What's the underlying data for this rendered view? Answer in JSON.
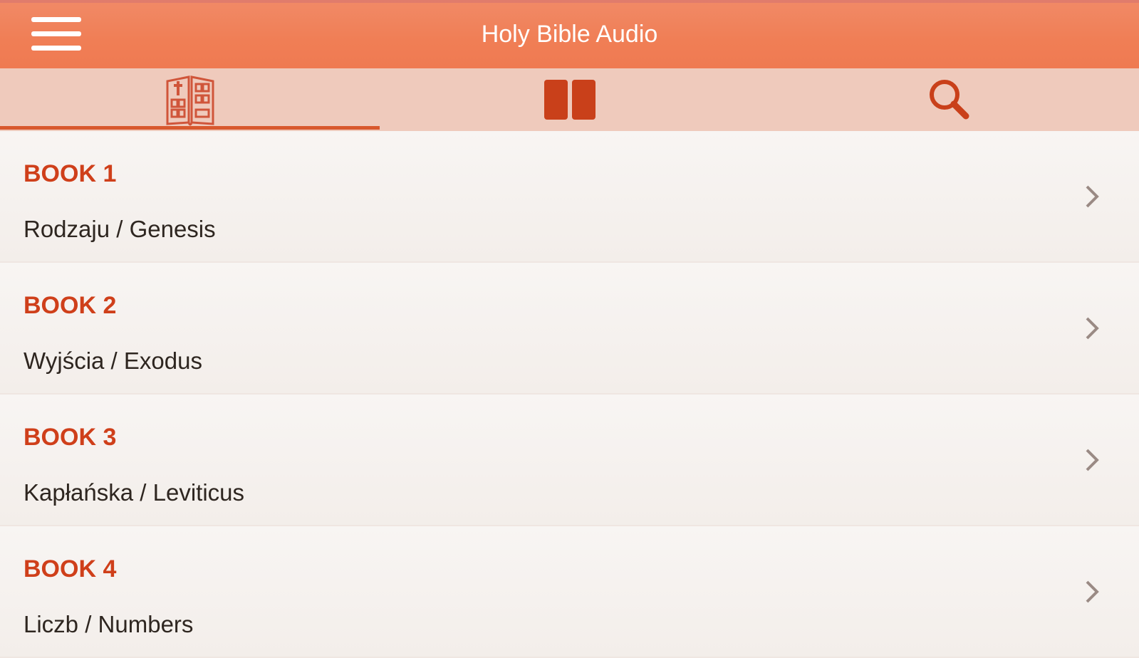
{
  "header": {
    "title": "Holy Bible Audio",
    "menu_icon": "hamburger-menu-icon"
  },
  "tabs": [
    {
      "icon": "bible-book-icon",
      "active": true
    },
    {
      "icon": "open-book-icon",
      "active": false
    },
    {
      "icon": "search-icon",
      "active": false
    }
  ],
  "books": [
    {
      "number": "BOOK 1",
      "name": "Rodzaju / Genesis"
    },
    {
      "number": "BOOK 2",
      "name": "Wyjścia / Exodus"
    },
    {
      "number": "BOOK 3",
      "name": "Kapłańska / Leviticus"
    },
    {
      "number": "BOOK 4",
      "name": "Liczb / Numbers"
    }
  ],
  "colors": {
    "accent": "#cf3f1a",
    "header": "#f07e55",
    "tabbar": "#efcabc"
  }
}
